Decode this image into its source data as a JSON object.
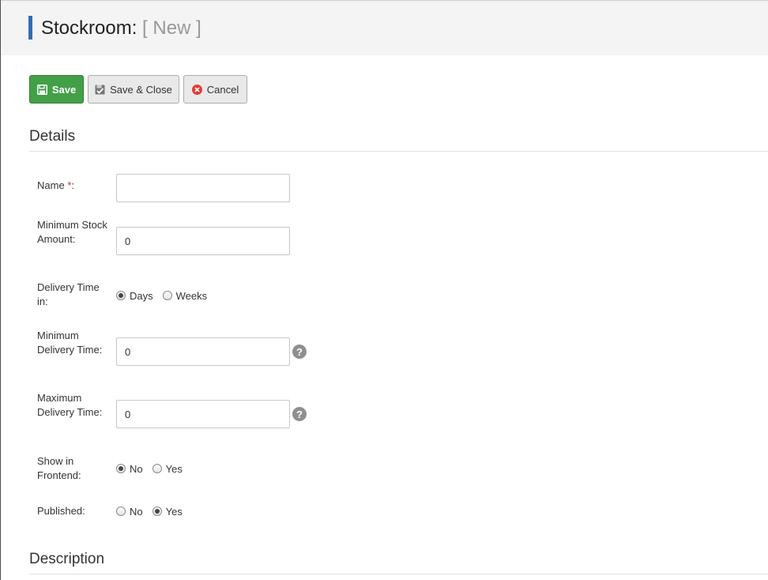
{
  "header": {
    "title": "Stockroom:",
    "subtitle": "[ New ]"
  },
  "toolbar": {
    "save_label": "Save",
    "save_close_label": "Save & Close",
    "cancel_label": "Cancel",
    "save_color": "#43a047",
    "cancel_icon_color": "#e53935"
  },
  "sections": {
    "details": "Details",
    "description": "Description"
  },
  "form": {
    "name": {
      "label": "Name",
      "required_mark": "*",
      "suffix": ":",
      "value": ""
    },
    "min_stock": {
      "label": "Minimum Stock Amount:",
      "value": "0"
    },
    "delivery_unit": {
      "label": "Delivery Time in:",
      "options": [
        {
          "label": "Days",
          "checked": true
        },
        {
          "label": "Weeks",
          "checked": false
        }
      ]
    },
    "min_delivery": {
      "label": "Minimum Delivery Time:",
      "value": "0",
      "help_icon": "question-circle-icon"
    },
    "max_delivery": {
      "label": "Maximum Delivery Time:",
      "value": "0",
      "help_icon": "question-circle-icon"
    },
    "show_frontend": {
      "label": "Show in Frontend:",
      "options": [
        {
          "label": "No",
          "checked": true
        },
        {
          "label": "Yes",
          "checked": false
        }
      ]
    },
    "published": {
      "label": "Published:",
      "options": [
        {
          "label": "No",
          "checked": false
        },
        {
          "label": "Yes",
          "checked": true
        }
      ]
    }
  }
}
